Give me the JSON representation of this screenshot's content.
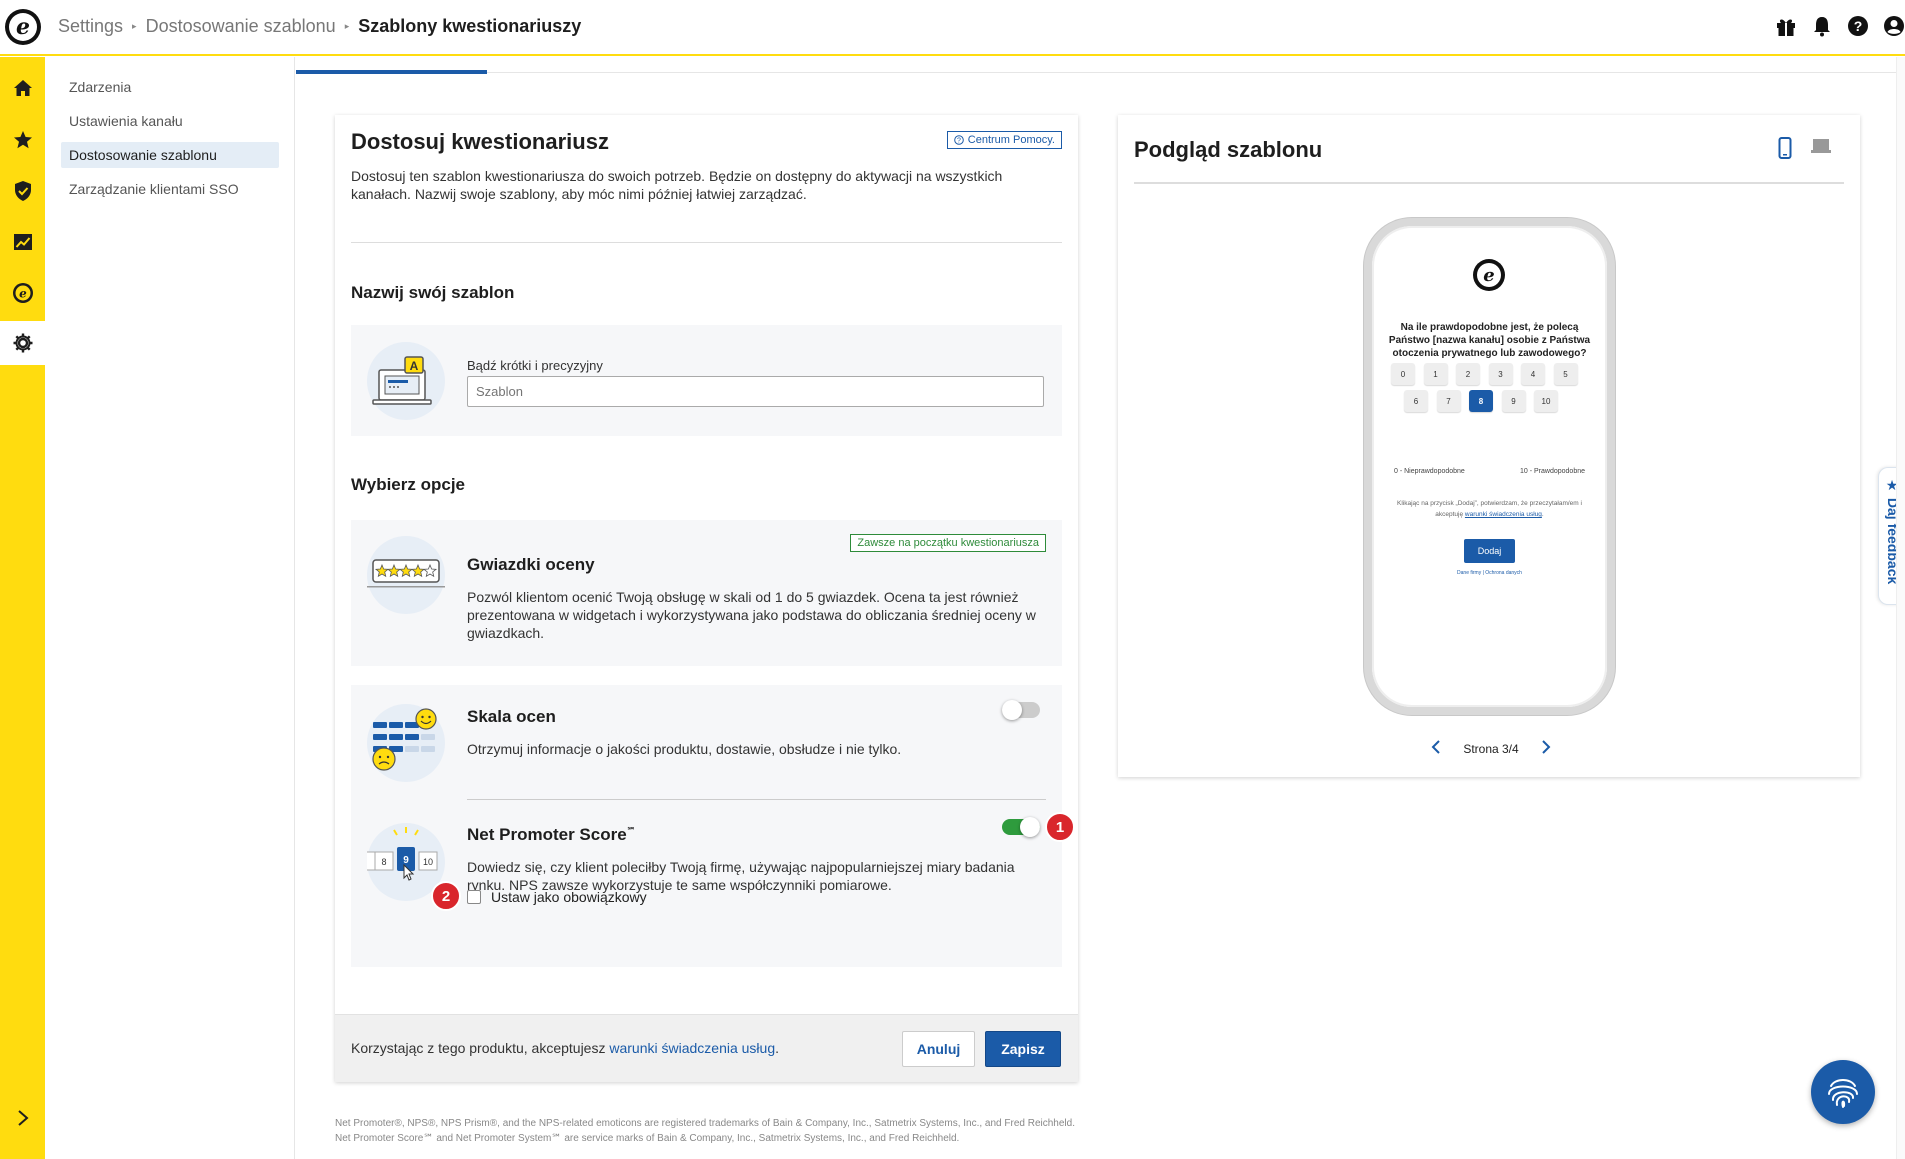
{
  "app": {
    "logo_letter": "e"
  },
  "breadcrumb": {
    "items": [
      "Settings",
      "Dostosowanie szablonu"
    ],
    "current": "Szablony kwestionariuszy"
  },
  "subnav": {
    "items": [
      {
        "label": "Zdarzenia"
      },
      {
        "label": "Ustawienia kanału"
      },
      {
        "label": "Dostosowanie szablonu",
        "active": true
      },
      {
        "label": "Zarządzanie klientami SSO"
      }
    ]
  },
  "card": {
    "title": "Dostosuj kwestionariusz",
    "help_label": "Centrum Pomocy.",
    "description": "Dostosuj ten szablon kwestionariusza do swoich potrzeb. Będzie on dostępny do aktywacji na wszystkich kanałach. Nazwij swoje szablony, aby móc nimi później łatwiej zarządzać.",
    "name_section_title": "Nazwij swój szablon",
    "name_input_label": "Bądź krótki i precyzyjny",
    "name_input_placeholder": "Szablon",
    "options_section_title": "Wybierz opcje",
    "options": {
      "stars": {
        "title": "Gwiazdki oceny",
        "badge": "Zawsze na początku kwestionariusza",
        "description": "Pozwól klientom ocenić Twoją obsługę w skali od 1 do 5 gwiazdek. Ocena ta jest również prezentowana w widgetach i wykorzystywana jako podstawa do obliczania średniej oceny w gwiazdkach."
      },
      "scale": {
        "title": "Skala ocen",
        "description": "Otrzymuj informacje o jakości produktu, dostawie, obsłudze i nie tylko.",
        "enabled": false
      },
      "nps": {
        "title": "Net Promoter Score",
        "title_mark": "℠",
        "description": "Dowiedz się, czy klient poleciłby Twoją firmę, używając najpopularniejszej miary badania rynku. NPS zawsze wykorzystuje te same współczynniki pomiarowe.",
        "enabled": true,
        "mandatory_label": "Ustaw jako obowiązkowy",
        "mandatory": false,
        "illustration_numbers": [
          "8",
          "9",
          "10"
        ]
      }
    },
    "markers": [
      "1",
      "2"
    ],
    "footer": {
      "text_prefix": "Korzystając z tego produktu, akceptujesz ",
      "link": "warunki świadczenia usług",
      "text_suffix": ".",
      "cancel_label": "Anuluj",
      "save_label": "Zapisz"
    }
  },
  "legal": "Net Promoter®, NPS®, NPS Prism®, and the NPS-related emoticons are registered trademarks of Bain & Company, Inc., Satmetrix Systems, Inc., and Fred Reichheld. Net Promoter Score℠ and Net Promoter System℠ are service marks of Bain & Company, Inc., Satmetrix Systems, Inc., and Fred Reichheld.",
  "preview": {
    "title": "Podgląd szablonu",
    "question": "Na ile prawdopodobne jest, że polecą Państwo [nazwa kanału] osobie z Państwa otoczenia prywatnego lub zawodowego?",
    "scores_row1": [
      "0",
      "1",
      "2",
      "3",
      "4",
      "5"
    ],
    "scores_row2": [
      "6",
      "7",
      "8",
      "9",
      "10"
    ],
    "selected_score": "8",
    "scale_low": "0 - Nieprawdopodobne",
    "scale_high": "10 - Prawdopodobne",
    "consent_prefix": "Klikając na przycisk „Dodaj”, potwierdzam, że przeczytałam/em i akceptuję ",
    "consent_link": "warunki świadczenia usług",
    "consent_suffix": ".",
    "submit_label": "Dodaj",
    "footer_links": "Dane firmy | Ochrona danych",
    "pager": "Strona 3/4"
  },
  "feedback": {
    "label": "★ Daj feedback"
  },
  "colors": {
    "brand_yellow": "#ffdc0f",
    "accent_blue": "#1b5ba8",
    "toggle_on": "#2e9b3d",
    "marker_red": "#d9262c"
  }
}
